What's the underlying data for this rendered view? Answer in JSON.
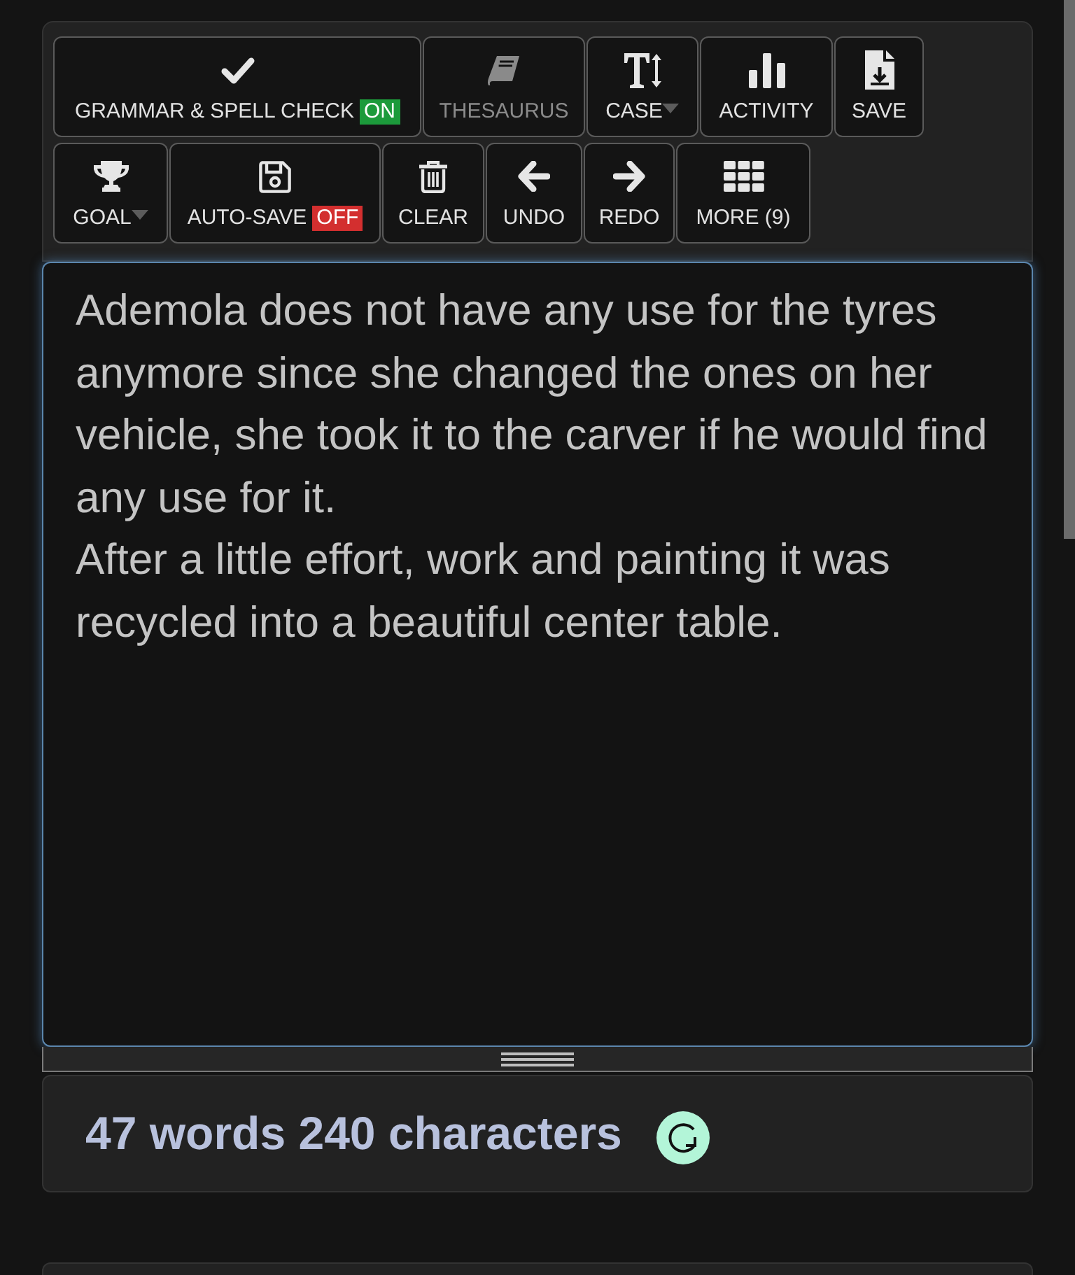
{
  "toolbar": {
    "buttons": [
      {
        "label": "GRAMMAR & SPELL CHECK",
        "badge": {
          "text": "ON",
          "on": true
        },
        "disabled": false,
        "dropdown": false
      },
      {
        "label": "THESAURUS",
        "disabled": true,
        "dropdown": false
      },
      {
        "label": "CASE",
        "disabled": false,
        "dropdown": true
      },
      {
        "label": "ACTIVITY",
        "disabled": false,
        "dropdown": false
      },
      {
        "label": "SAVE",
        "disabled": false,
        "dropdown": false
      },
      {
        "label": "GOAL",
        "disabled": false,
        "dropdown": true
      },
      {
        "label": "AUTO-SAVE",
        "badge": {
          "text": "OFF",
          "on": false
        },
        "disabled": false,
        "dropdown": false
      },
      {
        "label": "CLEAR",
        "disabled": false,
        "dropdown": false
      },
      {
        "label": "UNDO",
        "disabled": false,
        "dropdown": false
      },
      {
        "label": "REDO",
        "disabled": false,
        "dropdown": false
      },
      {
        "label": "MORE (9)",
        "disabled": false,
        "dropdown": false
      }
    ]
  },
  "editor": {
    "paragraphs": [
      "Ademola does not have any use for the tyres anymore since she changed the ones on her vehicle, she took it to the carver if he would find any use for it.",
      "After a little effort, work and painting it was recycled into a beautiful center table."
    ]
  },
  "stats": {
    "text": "47 words 240 characters"
  }
}
